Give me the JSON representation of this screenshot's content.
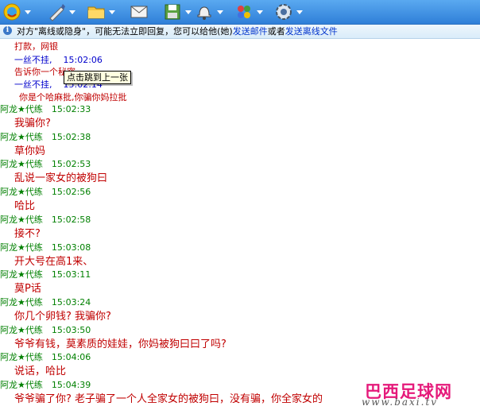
{
  "toolbar": {
    "icons": [
      "qq-icon",
      "pen-icon",
      "folder-icon",
      "mail-icon",
      "save-icon",
      "bell-icon",
      "apps-icon",
      "gear-icon"
    ]
  },
  "infobar": {
    "text": "对方\"离线或隐身\"，可能无法立即回复，您可以给他(她)",
    "link1": "发送邮件",
    "middle": "或者",
    "link2": "发送离线文件"
  },
  "tooltip": "点击跳到上一张",
  "chat": {
    "top_lines": [
      {
        "text": "打款，网银"
      },
      {
        "name": "一丝不挂,",
        "time": "15:02:06"
      },
      {
        "text": "告诉你一个秘密"
      },
      {
        "name": "一丝不挂,",
        "time": "15:02:14"
      },
      {
        "text": "你是个哈麻批,你骗你妈拉批"
      }
    ],
    "messages": [
      {
        "name": "阿龙★代练",
        "time": "15:02:33",
        "text": "我骗你?"
      },
      {
        "name": "阿龙★代练",
        "time": "15:02:38",
        "text": "草你妈"
      },
      {
        "name": "阿龙★代练",
        "time": "15:02:53",
        "text": "乱说一家女的被狗曰"
      },
      {
        "name": "阿龙★代练",
        "time": "15:02:56",
        "text": "哈比"
      },
      {
        "name": "阿龙★代练",
        "time": "15:02:58",
        "text": "接不?"
      },
      {
        "name": "阿龙★代练",
        "time": "15:03:08",
        "text": "开大号在高1来、"
      },
      {
        "name": "阿龙★代练",
        "time": "15:03:11",
        "text": "莫P话"
      },
      {
        "name": "阿龙★代练",
        "time": "15:03:24",
        "text": "你几个卵钱? 我骗你?"
      },
      {
        "name": "阿龙★代练",
        "time": "15:03:50",
        "text": "爷爷有钱，莫素质的娃娃，你妈被狗曰曰了吗?"
      },
      {
        "name": "阿龙★代练",
        "time": "15:04:06",
        "text": "说话，哈比"
      },
      {
        "name": "阿龙★代练",
        "time": "15:04:39",
        "text": "爷爷骗了你? 老子骗了一个人全家女的被狗曰，没有骗，你全家女的"
      }
    ]
  },
  "watermark": {
    "title": "巴西足球网",
    "url": "www.baxi.tv"
  }
}
